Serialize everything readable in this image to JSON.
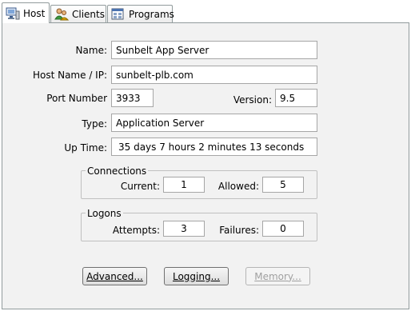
{
  "tabs": [
    {
      "label": "Host",
      "icon": "host-icon",
      "active": true
    },
    {
      "label": "Clients",
      "icon": "clients-icon",
      "active": false
    },
    {
      "label": "Programs",
      "icon": "programs-icon",
      "active": false
    }
  ],
  "form": {
    "name_label": "Name:",
    "name_value": "Sunbelt App Server",
    "hostname_label": "Host Name / IP:",
    "hostname_value": "sunbelt-plb.com",
    "port_label": "Port Number",
    "port_value": "3933",
    "version_label": "Version:",
    "version_value": "9.5",
    "type_label": "Type:",
    "type_value": "Application Server",
    "uptime_label": "Up Time:",
    "uptime_value": "35 days  7 hours  2 minutes 13 seconds"
  },
  "connections": {
    "title": "Connections",
    "current_label": "Current:",
    "current_value": "1",
    "allowed_label": "Allowed:",
    "allowed_value": "5"
  },
  "logons": {
    "title": "Logons",
    "attempts_label": "Attempts:",
    "attempts_value": "3",
    "failures_label": "Failures:",
    "failures_value": "0"
  },
  "buttons": {
    "advanced": "Advanced...",
    "logging": "Logging...",
    "memory": "Memory..."
  }
}
